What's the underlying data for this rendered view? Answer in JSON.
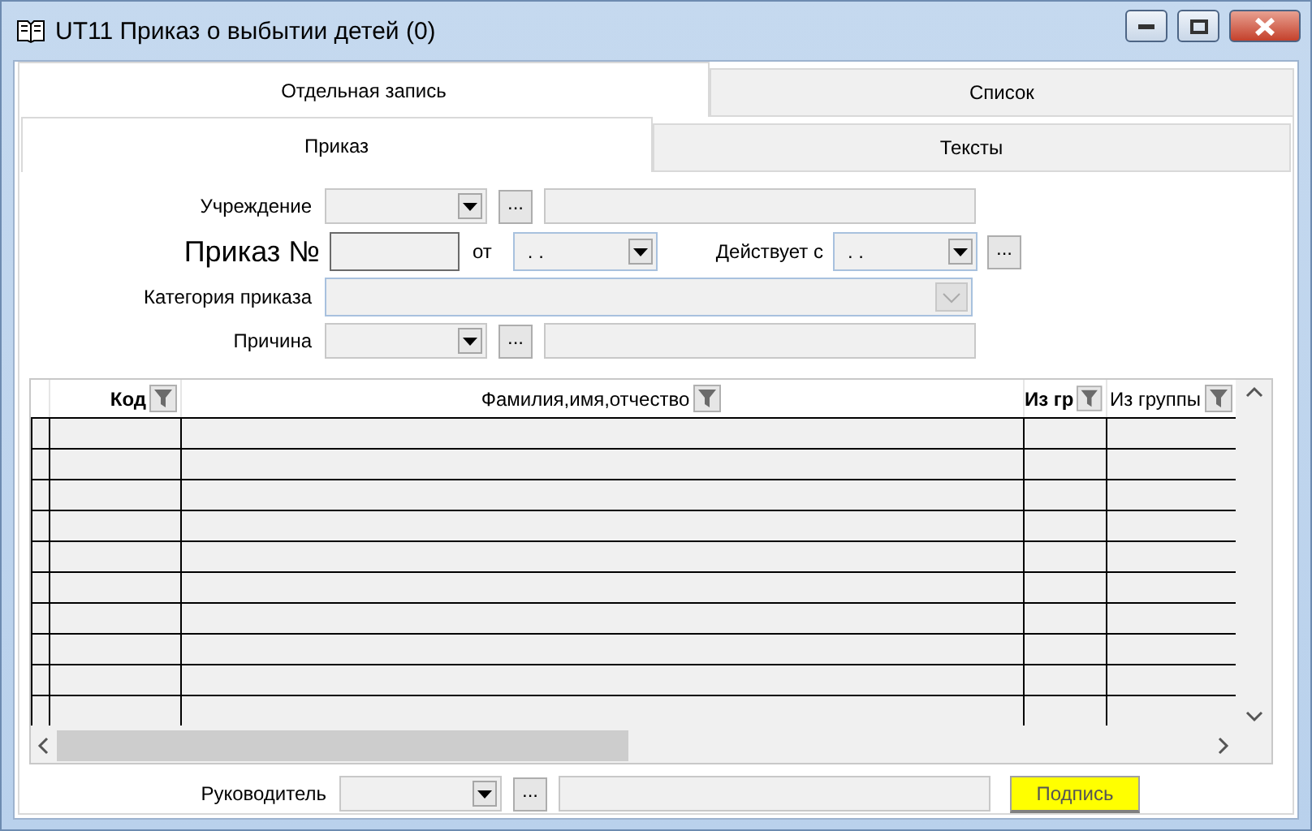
{
  "window": {
    "title": "UT11 Приказ о выбытии детей (0)"
  },
  "tabs": [
    {
      "label": "Отдельная запись",
      "selected": true
    },
    {
      "label": "Список",
      "selected": false
    }
  ],
  "subtabs": [
    {
      "label": "Приказ",
      "selected": true
    },
    {
      "label": "Тексты",
      "selected": false
    }
  ],
  "form": {
    "institution": {
      "label": "Учреждение",
      "button": "..."
    },
    "order": {
      "label": "Приказ №",
      "from_label": "от",
      "from_value": ". .",
      "valid_label": "Действует с",
      "valid_value": ". .",
      "button": "..."
    },
    "category": {
      "label": "Категория приказа",
      "disabled": true
    },
    "reason": {
      "label": "Причина",
      "button": "..."
    }
  },
  "table": {
    "columns": [
      {
        "label": "Код",
        "bold": true
      },
      {
        "label": "Фамилия,имя,отчество",
        "bold": false
      },
      {
        "label": "Из гр",
        "bold": true
      },
      {
        "label": "Из группы",
        "bold": false
      }
    ]
  },
  "footer": {
    "label": "Руководитель",
    "button": "...",
    "sign_button": "Подпись"
  }
}
